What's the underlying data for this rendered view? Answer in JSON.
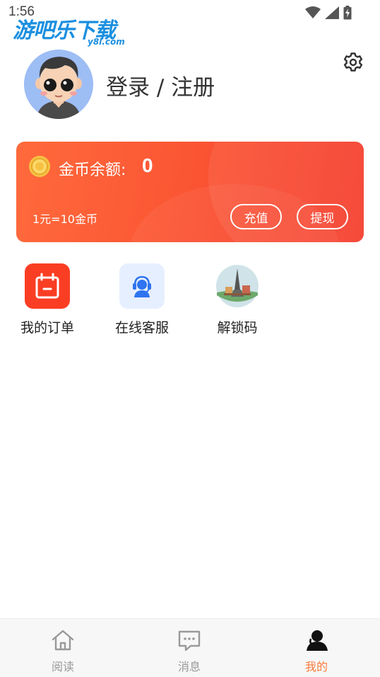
{
  "status_bar": {
    "time": "1:56"
  },
  "watermark": {
    "title": "游吧乐下载",
    "subtitle": "y8l.com"
  },
  "profile": {
    "login_text": "登录 / 注册"
  },
  "coin_card": {
    "label": "金币余额:",
    "value": "0",
    "rate": "1元=10金币",
    "recharge_label": "充值",
    "withdraw_label": "提现"
  },
  "actions": [
    {
      "label": "我的订单",
      "icon": "calendar-icon"
    },
    {
      "label": "在线客服",
      "icon": "headset-agent-icon"
    },
    {
      "label": "解锁码",
      "icon": "eiffel-tower-icon"
    }
  ],
  "bottom_nav": [
    {
      "label": "阅读",
      "icon": "home-icon",
      "active": false
    },
    {
      "label": "消息",
      "icon": "message-icon",
      "active": false
    },
    {
      "label": "我的",
      "icon": "user-icon",
      "active": true
    }
  ],
  "colors": {
    "accent": "#fa7a3c",
    "card_gradient_start": "#ff6a3c",
    "card_gradient_end": "#f53d2d",
    "orders_icon_bg": "#fa3e24",
    "service_icon_bg": "#e6efff"
  }
}
